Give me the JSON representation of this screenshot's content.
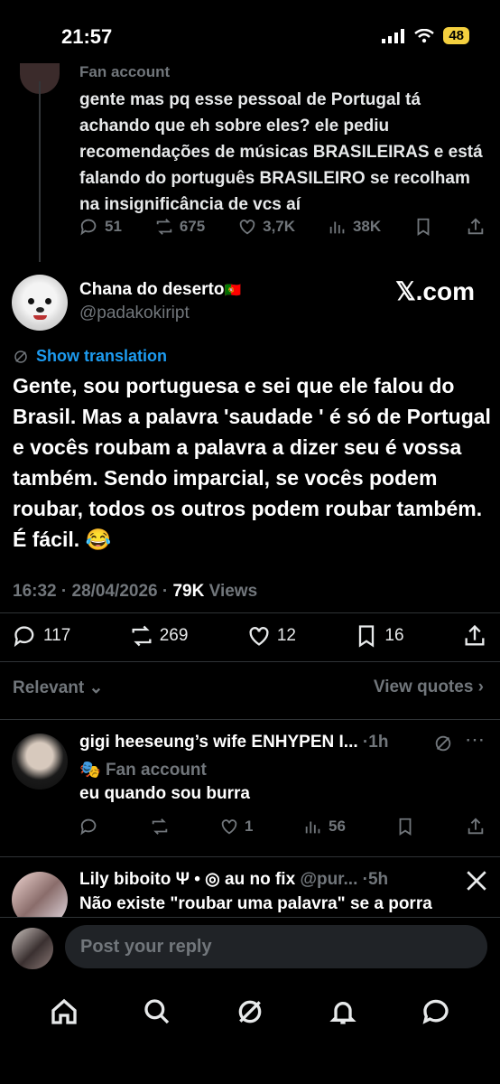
{
  "status": {
    "time": "21:57",
    "battery": "48"
  },
  "parent_tweet": {
    "fan_label": "Fan account",
    "text": "gente mas pq esse pessoal de Portugal tá achando que eh sobre eles? ele pediu recomendações de músicas BRASILEIRAS e está falando do português BRASILEIRO se recolham na insignificância de vcs aí",
    "replies": "51",
    "reposts": "675",
    "likes": "3,7K",
    "views": "38K"
  },
  "main_tweet": {
    "name": "Chana do deserto",
    "flag": "🇵🇹",
    "handle": "@padakokiript",
    "source": "𝕏.com",
    "translate_label": "Show translation",
    "text": "Gente, sou portuguesa e sei que ele falou do Brasil. Mas a palavra 'saudade ' é só de Portugal e vocês roubam a palavra a dizer seu é vossa também. Sendo imparcial, se vocês podem roubar, todos os outros podem roubar também. É fácil. 😂",
    "time": "16:32",
    "date": "28/04/2026",
    "views_count": "79K",
    "views_label": "Views",
    "replies": "117",
    "reposts": "269",
    "likes": "12",
    "bookmarks": "16"
  },
  "sort": {
    "label": "Relevant",
    "view_quotes": "View quotes"
  },
  "reply1": {
    "name": "gigi heeseung’s wife ENHYPEN I...",
    "time": "1h",
    "fan_label": "Fan account",
    "text": "eu quando sou burra",
    "likes": "1",
    "views": "56"
  },
  "reply2": {
    "name": "Lily biboito Ψ • ◎ au no fix",
    "handle": "@pur...",
    "time": "5h",
    "text": "Não existe \"roubar uma palavra\" se a porra"
  },
  "compose": {
    "placeholder": "Post your reply"
  }
}
